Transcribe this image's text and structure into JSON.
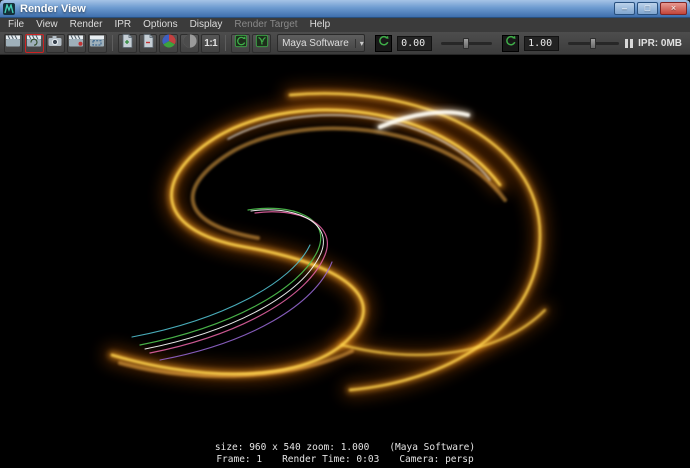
{
  "window": {
    "title": "Render View",
    "controls": {
      "minimize": "–",
      "maximize": "□",
      "close": "×"
    }
  },
  "menu": {
    "items": [
      "File",
      "View",
      "Render",
      "IPR",
      "Options",
      "Display",
      "Render Target",
      "Help"
    ]
  },
  "toolbar": {
    "renderer": "Maya Software",
    "dropdown_arrow": "▾",
    "real_size_label": "1:1",
    "exposure_value": "0.00",
    "gamma_value": "1.00",
    "ipr_memory": "IPR: 0MB"
  },
  "status": {
    "size_zoom": "size: 960 x 540 zoom: 1.000",
    "renderer_note": "(Maya Software)",
    "frame": "Frame: 1",
    "render_time": "Render Time: 0:03",
    "camera": "Camera: persp"
  },
  "colors": {
    "titlebar_blue": "#6d9bd0",
    "selection_red": "#cc2222",
    "accent_green": "#3fae49",
    "trail_orange": "#ffa000"
  }
}
